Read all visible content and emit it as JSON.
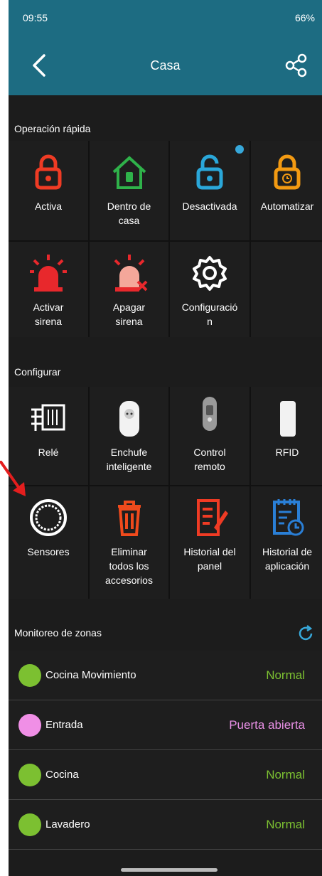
{
  "status": {
    "time": "09:55",
    "battery": "66%"
  },
  "appbar": {
    "title": "Casa"
  },
  "sections": {
    "quick": "Operación rápida",
    "config": "Configurar",
    "zones": "Monitoreo de zonas"
  },
  "quick_items": [
    {
      "label": "Activa",
      "icon": "lock-closed-icon",
      "color": "#ef3b24"
    },
    {
      "label": "Dentro de\ncasa",
      "icon": "home-lock-icon",
      "color": "#2fb24a"
    },
    {
      "label": "Desactivada",
      "icon": "lock-open-icon",
      "color": "#2aa7d9"
    },
    {
      "label": "Automatizar",
      "icon": "lock-timer-icon",
      "color": "#f39a12"
    },
    {
      "label": "Activar\nsirena",
      "icon": "siren-icon",
      "color": "#e8282c"
    },
    {
      "label": "Apagar\nsirena",
      "icon": "siren-off-icon",
      "color": "#e8282c"
    },
    {
      "label": "Configuració\nn",
      "icon": "gear-icon",
      "color": "#ffffff"
    }
  ],
  "config_items": [
    {
      "label": "Relé",
      "icon": "relay-icon"
    },
    {
      "label": "Enchufe\ninteligente",
      "icon": "smart-plug-icon"
    },
    {
      "label": "Control\nremoto",
      "icon": "remote-control-icon"
    },
    {
      "label": "RFID",
      "icon": "rfid-tag-icon"
    },
    {
      "label": "Sensores",
      "icon": "sensor-ring-icon"
    },
    {
      "label": "Eliminar\ntodos los\naccesorios",
      "icon": "trash-icon"
    },
    {
      "label": "Historial del\npanel",
      "icon": "panel-history-icon"
    },
    {
      "label": "Historial de\naplicación",
      "icon": "app-history-icon"
    }
  ],
  "zones": [
    {
      "name": "Cocina Movimiento",
      "status": "Normal",
      "color": "#7cc031",
      "status_color": "#7cc031"
    },
    {
      "name": "Entrada",
      "status": "Puerta abierta",
      "color": "#f08fe6",
      "status_color": "#e78fe4"
    },
    {
      "name": "Cocina",
      "status": "Normal",
      "color": "#7cc031",
      "status_color": "#7cc031"
    },
    {
      "name": "Lavadero",
      "status": "Normal",
      "color": "#7cc031",
      "status_color": "#7cc031"
    }
  ]
}
